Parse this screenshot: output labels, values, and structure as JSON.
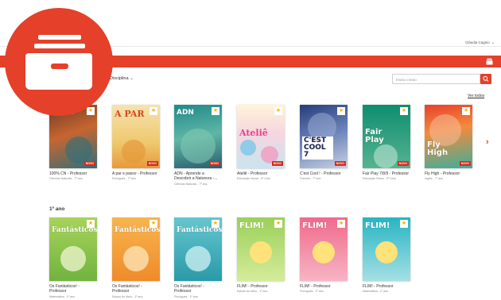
{
  "header": {
    "user_name": "Cláudia Cagnio"
  },
  "toolbar": {
    "filter_label": "Disciplina",
    "search_placeholder": "Insira o texto"
  },
  "sections": [
    {
      "title": "",
      "see_all": "Ver todos",
      "books": [
        {
          "title": "100% CN - Professor",
          "subtitle": "Ciências Naturais - 7º ano",
          "cover_text": "100%",
          "badge": "NOVO",
          "color": "#c7652f"
        },
        {
          "title": "A par e passo - Professor",
          "subtitle": "Português - 7º ano",
          "cover_text": "A PAR",
          "badge": "NOVO",
          "color": "#efc86e"
        },
        {
          "title": "ADN - Aprende a Descobrir a Natureza -...",
          "subtitle": "Ciências Naturais - 7º ano",
          "cover_text": "ADN",
          "badge": "NOVO",
          "color": "#1f8a8b"
        },
        {
          "title": "Ateliê - Professor",
          "subtitle": "Educação Visual - 3º Ciclo",
          "cover_text": "Ateliê",
          "badge": "NOVO",
          "color": "#e04687"
        },
        {
          "title": "C'est Cool ! - Professor",
          "subtitle": "Francês - 7º ano",
          "cover_text": "C'EST COOL 7",
          "badge": "NOVO",
          "color": "#263c7b"
        },
        {
          "title": "Fair Play 7/8/9 - Professor",
          "subtitle": "Educação Física - 3º Ciclo",
          "cover_text": "Fair Play",
          "badge": "NOVO",
          "color": "#0d8e6f"
        },
        {
          "title": "Fly High - Professor",
          "subtitle": "Inglês - 7º ano",
          "cover_text": "Fly High",
          "badge": "NOVO",
          "color": "#e8412c"
        }
      ]
    },
    {
      "title": "1º ano",
      "books": [
        {
          "title": "Os Fantásticos! - Professor",
          "subtitle": "Matemática - 1º ano",
          "cover_text": "Fantásticos",
          "color": "#71b340"
        },
        {
          "title": "Os Fantásticos! - Professor",
          "subtitle": "Estudo do Meio - 1º ano",
          "cover_text": "Fantásticos",
          "color": "#ef8b2a"
        },
        {
          "title": "Os Fantásticos! - Professor",
          "subtitle": "Português - 1º ano",
          "cover_text": "Fantásticos",
          "color": "#2b9aa8"
        },
        {
          "title": "FLIM! - Professor",
          "subtitle": "Estudo do Meio - 1º ano",
          "cover_text": "FLIM!",
          "color": "#9bd05a"
        },
        {
          "title": "FLIM! - Professor",
          "subtitle": "Português - 1º ano",
          "cover_text": "FLIM!",
          "color": "#f06a8c"
        },
        {
          "title": "FLIM! - Professor",
          "subtitle": "Matemática - 1º ano",
          "cover_text": "FLIM!",
          "color": "#27b5c2"
        }
      ]
    }
  ],
  "icons": {
    "logo": "archive-drawer-icon",
    "drawer": "drawer-icon",
    "search": "search-icon",
    "next": "chevron-right-icon",
    "favorite": "star-icon"
  },
  "colors": {
    "accent": "#e5402a",
    "badge": "#d52b1e"
  }
}
